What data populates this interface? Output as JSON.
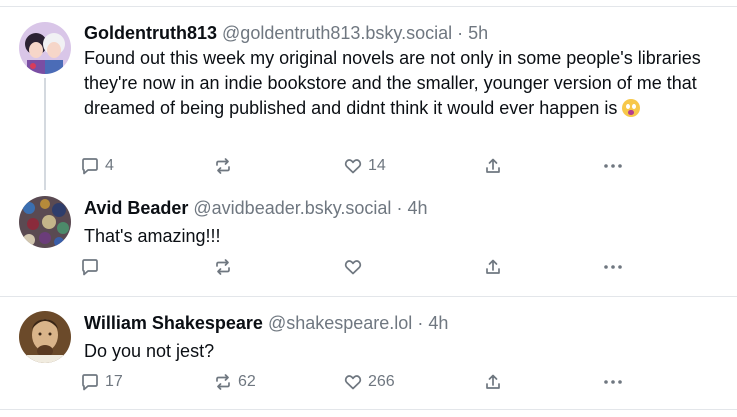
{
  "posts": [
    {
      "author": "Goldentruth813",
      "handle": "@goldentruth813.bsky.social",
      "separator": "·",
      "time": "5h",
      "text": "Found out this week my original novels are not only in some people's libraries they're now in an indie bookstore and the smaller, younger version of me that dreamed of being published and didnt think it would ever happen is",
      "emoji": "face-holding-back-tears",
      "replies": "4",
      "reposts": "",
      "likes": "14"
    },
    {
      "author": "Avid Beader",
      "handle": "@avidbeader.bsky.social",
      "separator": "·",
      "time": "4h",
      "text": "That's amazing!!!",
      "replies": "",
      "reposts": "",
      "likes": ""
    },
    {
      "author": "William Shakespeare",
      "handle": "@shakespeare.lol",
      "separator": "·",
      "time": "4h",
      "text": "Do you not jest?",
      "replies": "17",
      "reposts": "62",
      "likes": "266"
    }
  ],
  "icons": {
    "reply": "speech-bubble-icon",
    "repost": "repost-arrows-icon",
    "like": "heart-icon",
    "share": "share-upload-icon",
    "more": "more-dots-icon"
  },
  "colors": {
    "text": "#0b0f14",
    "muted": "#6f7780",
    "separator": "#e3e6ea"
  }
}
